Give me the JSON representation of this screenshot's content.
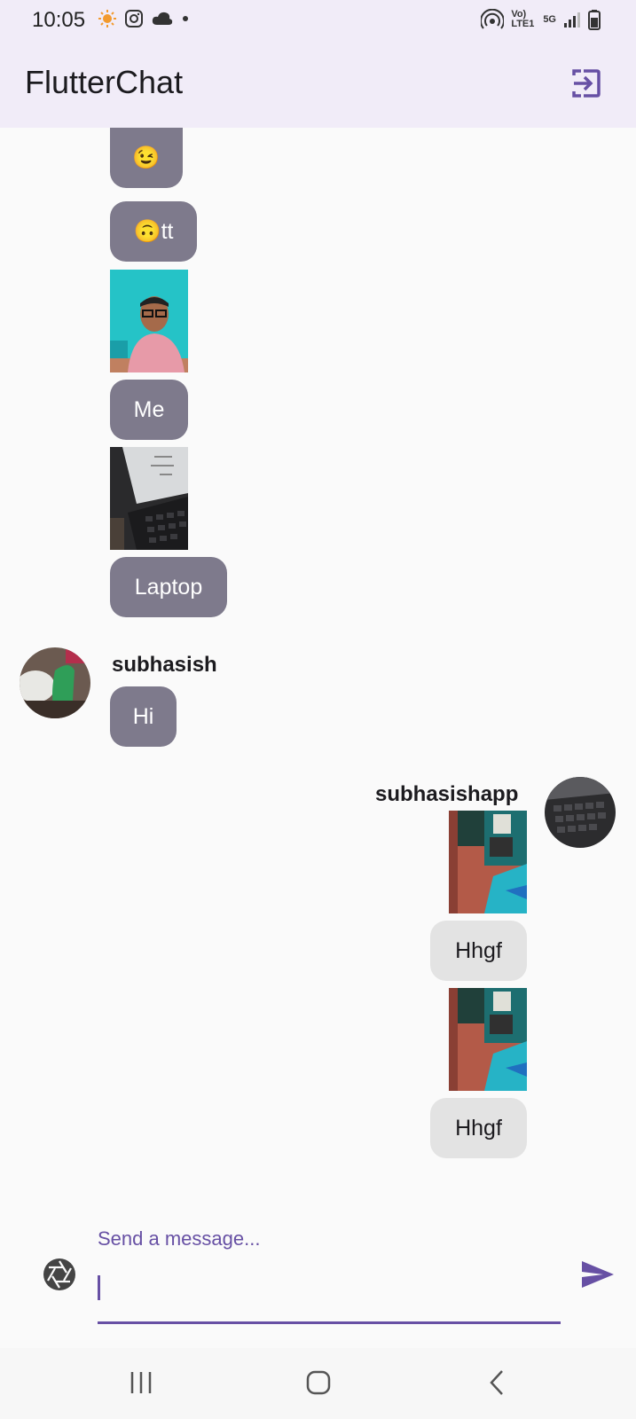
{
  "status_bar": {
    "time": "10:05",
    "left_icons": [
      "sun-icon",
      "instagram-icon",
      "cloud-icon",
      "dot-icon"
    ],
    "right_icons": [
      "hotspot-icon",
      "volte-icon",
      "5g-icon",
      "signal-icon",
      "battery-icon"
    ],
    "volte_label": "Vo) LTE1",
    "net_label": "5G"
  },
  "app_bar": {
    "title": "FlutterChat",
    "logout_icon": "logout-icon"
  },
  "messages": [
    {
      "type": "text",
      "side": "other",
      "text": "😉"
    },
    {
      "type": "text",
      "side": "other",
      "text": "🙃tt"
    },
    {
      "type": "image",
      "side": "other",
      "desc": "selfie photo"
    },
    {
      "type": "text",
      "side": "other",
      "text": "Me"
    },
    {
      "type": "image",
      "side": "other",
      "desc": "laptop photo"
    },
    {
      "type": "text",
      "side": "other",
      "text": "Laptop"
    },
    {
      "type": "text",
      "side": "other",
      "username": "subhasish",
      "text": "Hi"
    },
    {
      "type": "image",
      "side": "me",
      "username": "subhasishapp",
      "desc": "room photo"
    },
    {
      "type": "text",
      "side": "me",
      "text": "Hhgf"
    },
    {
      "type": "image",
      "side": "me",
      "desc": "room photo"
    },
    {
      "type": "text",
      "side": "me",
      "text": "Hhgf"
    }
  ],
  "users": {
    "other": "subhasish",
    "me": "subhasishapp"
  },
  "input": {
    "label": "Send a message...",
    "value": "",
    "camera_icon": "camera-icon",
    "send_icon": "send-icon"
  },
  "nav_bar": {
    "icons": [
      "recents-icon",
      "home-icon",
      "back-icon"
    ]
  },
  "colors": {
    "app_bar_bg": "#f1ecf8",
    "accent": "#6750a4",
    "other_bubble": "#7e7a8c",
    "my_bubble": "#e3e3e3"
  }
}
